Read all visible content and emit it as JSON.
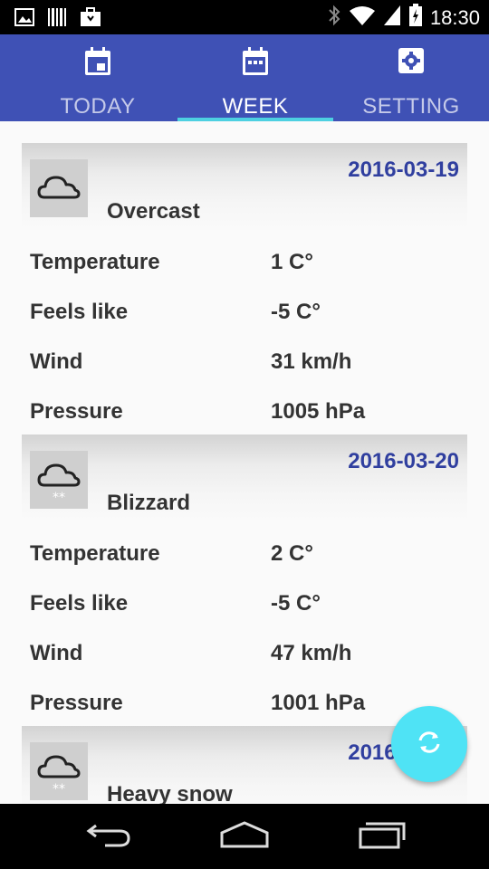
{
  "status_bar": {
    "time": "18:30",
    "left_icons": [
      "image-icon",
      "barcode-icon",
      "briefcase-icon"
    ],
    "right_icons": [
      "bluetooth-icon",
      "wifi-icon",
      "signal-icon",
      "battery-icon"
    ]
  },
  "tabs": [
    {
      "label": "TODAY",
      "icon": "calendar-today-icon",
      "active": false
    },
    {
      "label": "WEEK",
      "icon": "calendar-week-icon",
      "active": true
    },
    {
      "label": "SETTING",
      "icon": "settings-icon",
      "active": false
    }
  ],
  "days": [
    {
      "date": "2016-03-19",
      "condition": "Overcast",
      "icon": "cloud-icon",
      "rows": [
        {
          "label": "Temperature",
          "value": "1 C°"
        },
        {
          "label": "Feels like",
          "value": "-5 C°"
        },
        {
          "label": "Wind",
          "value": "31 km/h"
        },
        {
          "label": "Pressure",
          "value": "1005 hPa"
        }
      ]
    },
    {
      "date": "2016-03-20",
      "condition": "Blizzard",
      "icon": "cloud-snow-icon",
      "rows": [
        {
          "label": "Temperature",
          "value": "2 C°"
        },
        {
          "label": "Feels like",
          "value": "-5 C°"
        },
        {
          "label": "Wind",
          "value": "47 km/h"
        },
        {
          "label": "Pressure",
          "value": "1001 hPa"
        }
      ]
    },
    {
      "date": "2016-03-21",
      "condition": "Heavy snow",
      "icon": "cloud-snow-icon",
      "rows": []
    }
  ],
  "fab": {
    "icon": "refresh-icon"
  },
  "nav_bar": [
    "back-icon",
    "home-icon",
    "recents-icon"
  ],
  "colors": {
    "primary": "#3f51b5",
    "accent": "#4dd0e1",
    "date": "#303f9f"
  }
}
